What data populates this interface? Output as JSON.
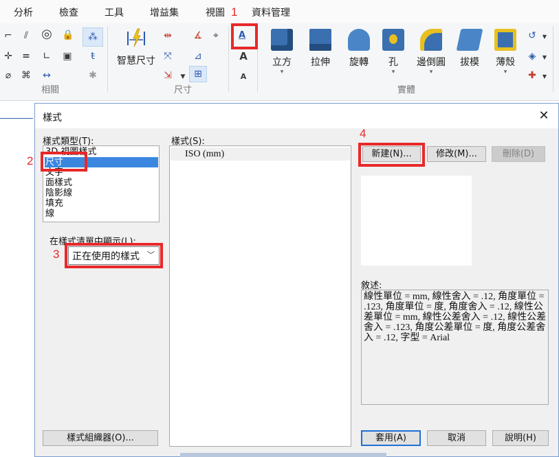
{
  "menu": {
    "items": [
      "分析",
      "檢查",
      "工具",
      "增益集",
      "視圖",
      "資料管理"
    ],
    "active_index": 3
  },
  "annotations": {
    "n1": "1",
    "n2": "2",
    "n3": "3",
    "n4": "4"
  },
  "ribbon": {
    "groups": {
      "relations": "相關",
      "dimension": "尺寸",
      "solid": "實體"
    },
    "buttons": {
      "smart_dimension": "智慧尺寸",
      "cube": "立方",
      "extrude": "拉伸",
      "revolve": "旋轉",
      "hole": "孔",
      "fillet": "邊倒圓",
      "draft": "拔模",
      "shell": "薄殼"
    }
  },
  "dialog": {
    "title": "樣式",
    "style_type_label": "樣式類型(T):",
    "style_types": [
      "3D 視圖樣式",
      "尺寸",
      "文字",
      "面樣式",
      "陰影線",
      "填充",
      "線"
    ],
    "selected_style_type": 1,
    "display_label": "在樣式清單中顯示(L):",
    "display_value": "正在使用的樣式",
    "styles_label": "樣式(S):",
    "styles": [
      "ISO (mm)"
    ],
    "buttons": {
      "new": "新建(N)...",
      "modify": "修改(M)...",
      "delete": "刪除(D)",
      "organizer": "樣式組織器(O)...",
      "apply": "套用(A)",
      "cancel": "取消",
      "help": "說明(H)"
    },
    "description_label": "敘述:",
    "description": "線性單位 = mm, 線性舍入 = .12, 角度單位 = .123, 角度單位 = 度, 角度舍入 = .12, 線性公差單位 = mm, 線性公差舍入 = .12, 線性公差舍入 = .123, 角度公差單位 = 度, 角度公差舍入 = .12, 字型 = Arial"
  },
  "colors": {
    "highlight": "#e8282a",
    "selection": "#3b87e0",
    "accent": "#2d5fa8"
  }
}
